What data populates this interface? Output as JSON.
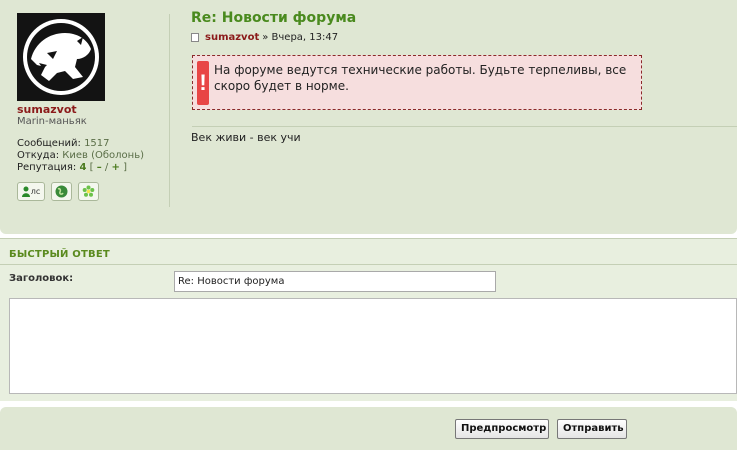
{
  "post": {
    "title": "Re: Новости форума",
    "author": "sumazvot",
    "date": "» Вчера, 13:47",
    "notice_text": "На форуме ведутся технические работы. Будьте терпеливы, все скоро будет в норме.",
    "signature": "Век живи - век учи"
  },
  "author_panel": {
    "name": "sumazvot",
    "rank": "Marin-маньяк",
    "posts_label": "Сообщений:",
    "posts_value": "1517",
    "from_label": "Откуда:",
    "from_value": "Киев (Оболонь)",
    "rep_label": "Репутация:",
    "rep_value": "4",
    "rep_open": "[",
    "rep_minus": "–",
    "rep_slash": "/",
    "rep_plus": "+",
    "rep_close": "]",
    "pm_label": "лс"
  },
  "quick_reply": {
    "title": "БЫСТРЫЙ ОТВЕТ",
    "subject_label": "Заголовок:",
    "subject_value": "Re: Новости форума"
  },
  "buttons": {
    "preview": "Предпросмотр",
    "submit": "Отправить"
  },
  "colors": {
    "accent_green": "#4a8a1e",
    "username_red": "#8b1a1a",
    "panel_bg": "#dfe7d3",
    "notice_bg": "#f6dede",
    "notice_icon": "#e84545"
  }
}
